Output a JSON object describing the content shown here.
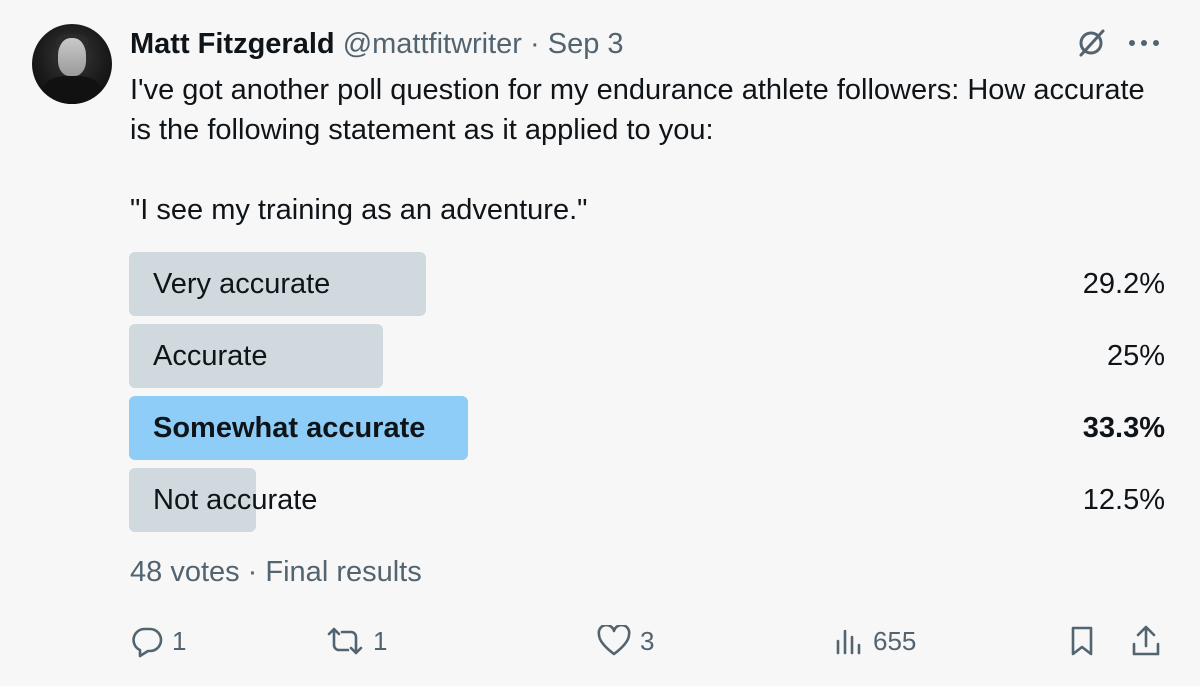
{
  "tweet": {
    "author_name": "Matt Fitzgerald",
    "handle": "@mattfitwriter",
    "separator": " · ",
    "date": "Sep 3",
    "text": "I've got another poll question for my endurance athlete followers: How accurate is the following statement as it applied to you:\n\n\"I see my training as an adventure.\""
  },
  "poll": {
    "options": [
      {
        "label": "Very accurate",
        "percent_text": "29.2%",
        "percent": 29.2,
        "winner": false
      },
      {
        "label": "Accurate",
        "percent_text": "25%",
        "percent": 25,
        "winner": false
      },
      {
        "label": "Somewhat accurate",
        "percent_text": "33.3%",
        "percent": 33.3,
        "winner": true
      },
      {
        "label": "Not accurate",
        "percent_text": "12.5%",
        "percent": 12.5,
        "winner": false
      }
    ],
    "footer": "48 votes · Final results"
  },
  "actions": {
    "replies": "1",
    "reposts": "1",
    "likes": "3",
    "views": "655"
  },
  "icons": {
    "avatar": "avatar-photo",
    "grok": "grok-icon",
    "more": "more-icon",
    "reply": "reply-icon",
    "repost": "repost-icon",
    "like": "heart-icon",
    "views": "views-icon",
    "bookmark": "bookmark-icon",
    "share": "share-icon"
  },
  "colors": {
    "bar_default": "#cfd9de",
    "bar_winner": "#8ecdf8",
    "text_secondary": "#536471"
  }
}
